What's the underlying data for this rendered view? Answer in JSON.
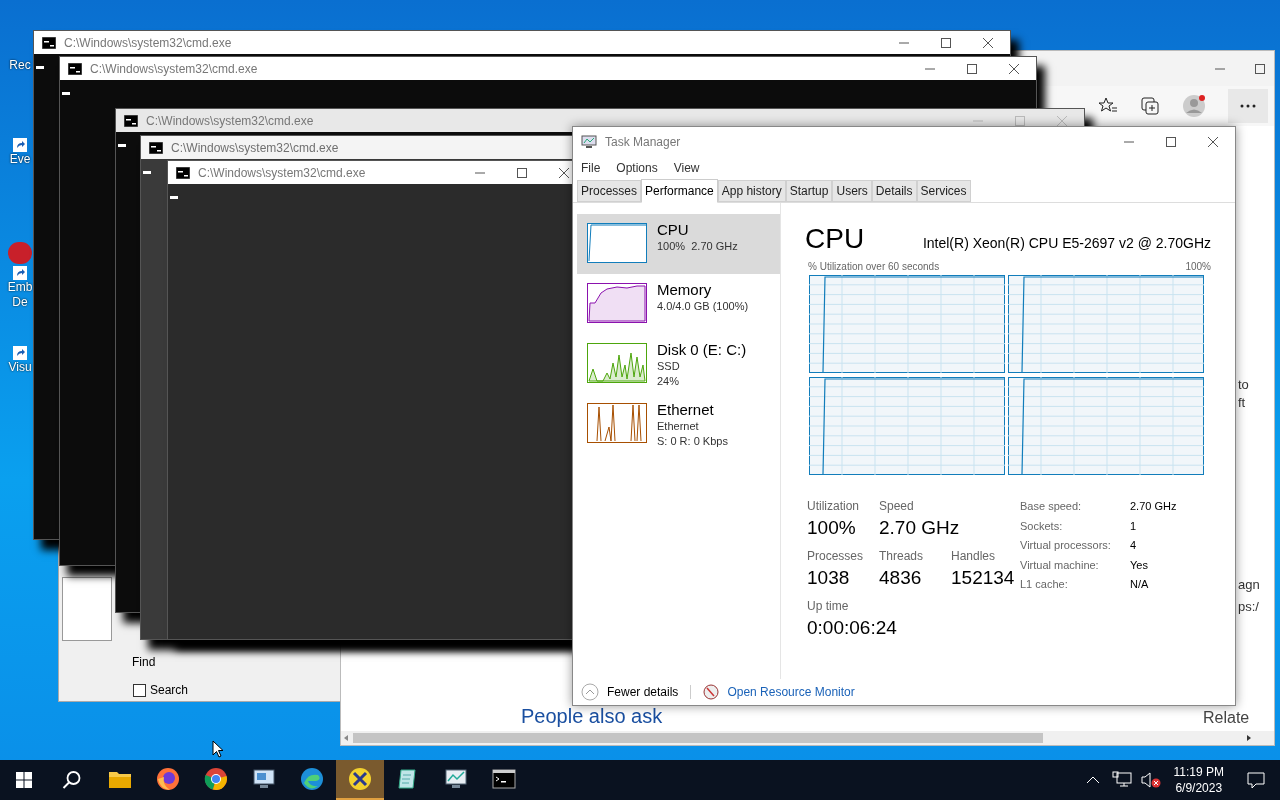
{
  "desktop_icons": [
    {
      "lines": [
        "Rec"
      ],
      "kind": "label_only"
    },
    {
      "lines": [
        "Eve"
      ],
      "kind": "shortcut"
    },
    {
      "lines": [
        "Emb",
        "De"
      ],
      "kind": "shortcut_red"
    },
    {
      "lines": [
        "Visu"
      ],
      "kind": "shortcut"
    }
  ],
  "background_dialog": {
    "find_label": "Find",
    "search_checkbox": {
      "label": "Search",
      "checked": false
    }
  },
  "browser": {
    "snippets": [
      {
        "text": "to"
      },
      {
        "text": "ft"
      },
      {
        "text": "agn"
      },
      {
        "text": "ps:/"
      }
    ],
    "heading": "People also ask",
    "related": "Relate"
  },
  "cmd_windows": [
    {
      "title": "C:\\Windows\\system32\\cmd.exe"
    },
    {
      "title": "C:\\Windows\\system32\\cmd.exe"
    },
    {
      "title": "C:\\Windows\\system32\\cmd.exe"
    },
    {
      "title": "C:\\Windows\\system32\\cmd.exe"
    },
    {
      "title": "C:\\Windows\\system32\\cmd.exe"
    }
  ],
  "task_manager": {
    "title": "Task Manager",
    "menu": [
      "File",
      "Options",
      "View"
    ],
    "tabs": [
      {
        "label": "Processes",
        "selected": false
      },
      {
        "label": "Performance",
        "selected": true
      },
      {
        "label": "App history",
        "selected": false
      },
      {
        "label": "Startup",
        "selected": false
      },
      {
        "label": "Users",
        "selected": false
      },
      {
        "label": "Details",
        "selected": false
      },
      {
        "label": "Services",
        "selected": false
      }
    ],
    "resources": [
      {
        "kind": "cpu",
        "name": "CPU",
        "lines": [
          "100%  2.70 GHz"
        ],
        "selected": true,
        "color": "#117dbb"
      },
      {
        "kind": "memory",
        "name": "Memory",
        "lines": [
          "4.0/4.0 GB (100%)"
        ],
        "selected": false,
        "color": "#8b12ae"
      },
      {
        "kind": "disk",
        "name": "Disk 0 (E: C:)",
        "lines": [
          "SSD",
          "24%"
        ],
        "selected": false,
        "color": "#4da60c"
      },
      {
        "kind": "ethernet",
        "name": "Ethernet",
        "lines": [
          "Ethernet",
          "S: 0 R: 0 Kbps"
        ],
        "selected": false,
        "color": "#a74f01"
      }
    ],
    "detail": {
      "title": "CPU",
      "model": "Intel(R) Xeon(R) CPU E5-2697 v2 @ 2.70GHz",
      "graph_label": "% Utilization over 60 seconds",
      "graph_max": "100%",
      "stats": [
        [
          {
            "label": "Utilization",
            "value": "100%"
          },
          {
            "label": "Speed",
            "value": "2.70 GHz"
          }
        ],
        [
          {
            "label": "Processes",
            "value": "1038"
          },
          {
            "label": "Threads",
            "value": "4836"
          },
          {
            "label": "Handles",
            "value": "152134"
          }
        ],
        [
          {
            "label": "Up time",
            "value": "0:00:06:24"
          }
        ]
      ],
      "specs": [
        {
          "label": "Base speed:",
          "value": "2.70 GHz"
        },
        {
          "label": "Sockets:",
          "value": "1"
        },
        {
          "label": "Virtual processors:",
          "value": "4"
        },
        {
          "label": "Virtual machine:",
          "value": "Yes"
        },
        {
          "label": "L1 cache:",
          "value": "N/A"
        }
      ]
    },
    "footer": {
      "fewer_details": "Fewer details",
      "link": "Open Resource Monitor"
    }
  },
  "taskbar": {
    "apps": [
      {
        "kind": "explorer",
        "selected": false
      },
      {
        "kind": "firefox",
        "selected": false
      },
      {
        "kind": "chrome",
        "selected": false
      },
      {
        "kind": "monitor",
        "selected": false
      },
      {
        "kind": "edge",
        "selected": false
      },
      {
        "kind": "xapp",
        "selected": true
      },
      {
        "kind": "notepad",
        "selected": false
      },
      {
        "kind": "taskmgr",
        "selected": false
      },
      {
        "kind": "cmd",
        "selected": false
      }
    ],
    "clock": {
      "time": "11:19 PM",
      "date": "6/9/2023"
    }
  }
}
